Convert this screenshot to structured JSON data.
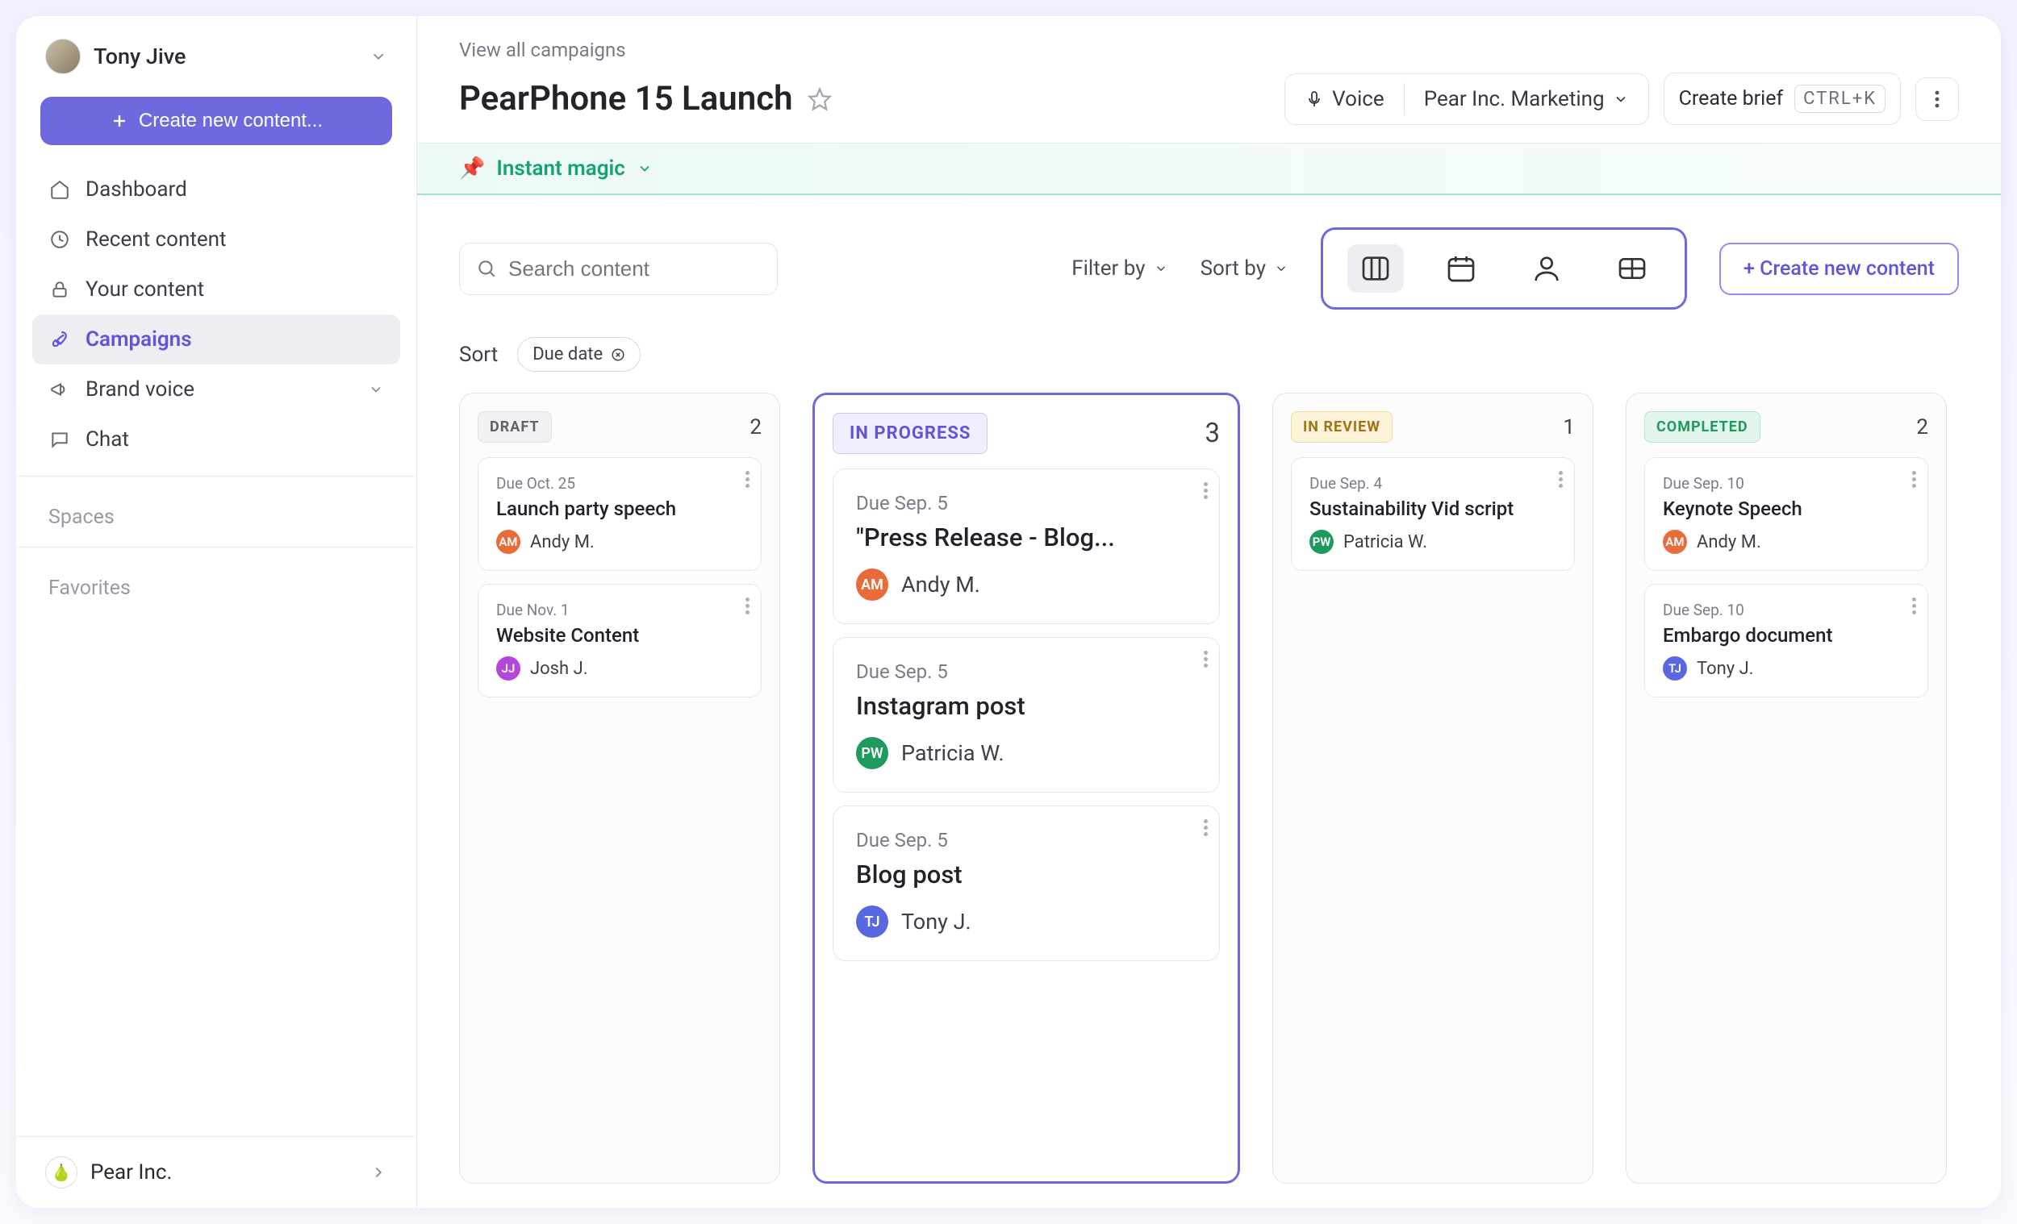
{
  "user": {
    "name": "Tony Jive"
  },
  "sidebar": {
    "create_label": "Create new content...",
    "items": [
      {
        "label": "Dashboard"
      },
      {
        "label": "Recent content"
      },
      {
        "label": "Your content"
      },
      {
        "label": "Campaigns"
      },
      {
        "label": "Brand voice"
      },
      {
        "label": "Chat"
      }
    ],
    "spaces_label": "Spaces",
    "favorites_label": "Favorites"
  },
  "footer": {
    "org": "Pear Inc."
  },
  "header": {
    "breadcrumb": "View all campaigns",
    "title": "PearPhone 15 Launch",
    "voice_label": "Voice",
    "persona": "Pear Inc. Marketing",
    "brief_label": "Create brief",
    "brief_kbd": "CTRL+K"
  },
  "magic": {
    "label": "Instant magic"
  },
  "search": {
    "placeholder": "Search content"
  },
  "filter_label": "Filter by",
  "sortby_label": "Sort by",
  "create_content_label": "+ Create new content",
  "sort": {
    "label": "Sort",
    "chip": "Due date"
  },
  "columns": [
    {
      "status": "DRAFT",
      "chipClass": "chip-draft",
      "count": "2",
      "cards": [
        {
          "due": "Due Oct. 25",
          "title": "Launch party speech",
          "assignee": "Andy M.",
          "initials": "AM",
          "avClass": "av-orange"
        },
        {
          "due": "Due Nov. 1",
          "title": "Website Content",
          "assignee": "Josh J.",
          "initials": "JJ",
          "avClass": "av-purple"
        }
      ]
    },
    {
      "status": "IN PROGRESS",
      "chipClass": "chip-progress",
      "count": "3",
      "big": true,
      "cards": [
        {
          "due": "Due Sep. 5",
          "title": "\"Press Release - Blog...",
          "assignee": "Andy M.",
          "initials": "AM",
          "avClass": "av-orange"
        },
        {
          "due": "Due Sep. 5",
          "title": "Instagram post",
          "assignee": "Patricia W.",
          "initials": "PW",
          "avClass": "av-green"
        },
        {
          "due": "Due Sep. 5",
          "title": "Blog post",
          "assignee": "Tony J.",
          "initials": "TJ",
          "avClass": "av-blue"
        }
      ]
    },
    {
      "status": "IN REVIEW",
      "chipClass": "chip-review",
      "count": "1",
      "cards": [
        {
          "due": "Due Sep. 4",
          "title": "Sustainability Vid script",
          "assignee": "Patricia W.",
          "initials": "PW",
          "avClass": "av-green"
        }
      ]
    },
    {
      "status": "COMPLETED",
      "chipClass": "chip-done",
      "count": "2",
      "cards": [
        {
          "due": "Due Sep. 10",
          "title": "Keynote Speech",
          "assignee": "Andy M.",
          "initials": "AM",
          "avClass": "av-orange"
        },
        {
          "due": "Due Sep. 10",
          "title": "Embargo document",
          "assignee": "Tony J.",
          "initials": "TJ",
          "avClass": "av-blue"
        }
      ]
    }
  ]
}
